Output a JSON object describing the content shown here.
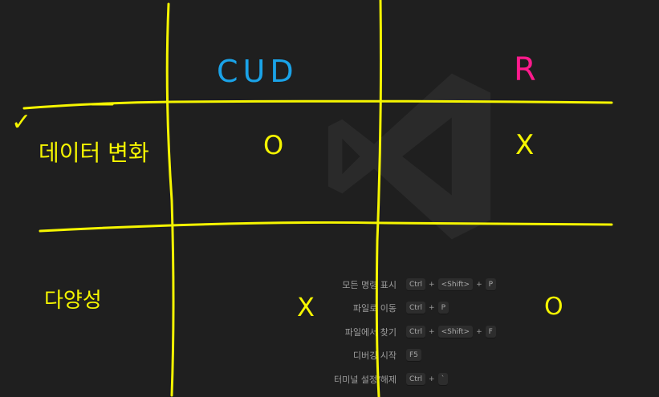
{
  "watermark": {
    "icon": "vscode-logo-icon"
  },
  "shortcuts": [
    {
      "label": "모든 명령 표시",
      "keys": [
        "Ctrl",
        "<Shift>",
        "P"
      ]
    },
    {
      "label": "파일로 이동",
      "keys": [
        "Ctrl",
        "P"
      ]
    },
    {
      "label": "파일에서 찾기",
      "keys": [
        "Ctrl",
        "<Shift>",
        "F"
      ]
    },
    {
      "label": "디버깅 시작",
      "keys": [
        "F5"
      ]
    },
    {
      "label": "터미널 설정/해제",
      "keys": [
        "Ctrl",
        "`"
      ]
    }
  ],
  "annotation": {
    "col_cud": "CUD",
    "col_r": "R",
    "row1": "데이터 변화",
    "row2": "다양성",
    "r1_cud": "O",
    "r1_r": "X",
    "r2_cud": "X",
    "r2_r": "O",
    "check": "✓",
    "colors": {
      "yellow": "#f5f500",
      "blue": "#1aa3e8",
      "pink": "#ff1a8c"
    }
  }
}
